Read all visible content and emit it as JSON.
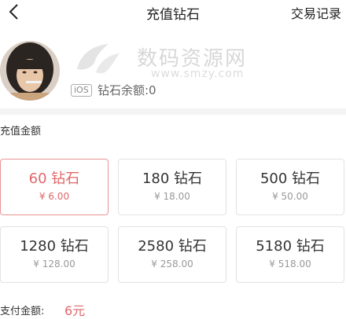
{
  "nav": {
    "title": "充值钻石",
    "right_link": "交易记录"
  },
  "profile": {
    "platform_badge": "iOS",
    "balance_text": "钻石余额:0"
  },
  "watermark": {
    "text": "数码资源网",
    "url": "www.smzy.com"
  },
  "section": {
    "label": "充值金额"
  },
  "options": [
    {
      "amount": "60 钻石",
      "price": "¥ 6.00",
      "selected": true
    },
    {
      "amount": "180 钻石",
      "price": "¥ 18.00",
      "selected": false
    },
    {
      "amount": "500 钻石",
      "price": "¥ 50.00",
      "selected": false
    },
    {
      "amount": "1280 钻石",
      "price": "¥ 128.00",
      "selected": false
    },
    {
      "amount": "2580 钻石",
      "price": "¥ 258.00",
      "selected": false
    },
    {
      "amount": "5180 钻石",
      "price": "¥ 518.00",
      "selected": false
    }
  ],
  "payment": {
    "label": "支付金额:",
    "value": "6元"
  },
  "colors": {
    "accent": "#e0676a",
    "selected_border": "#e89393",
    "card_border": "#e2e2e2"
  }
}
